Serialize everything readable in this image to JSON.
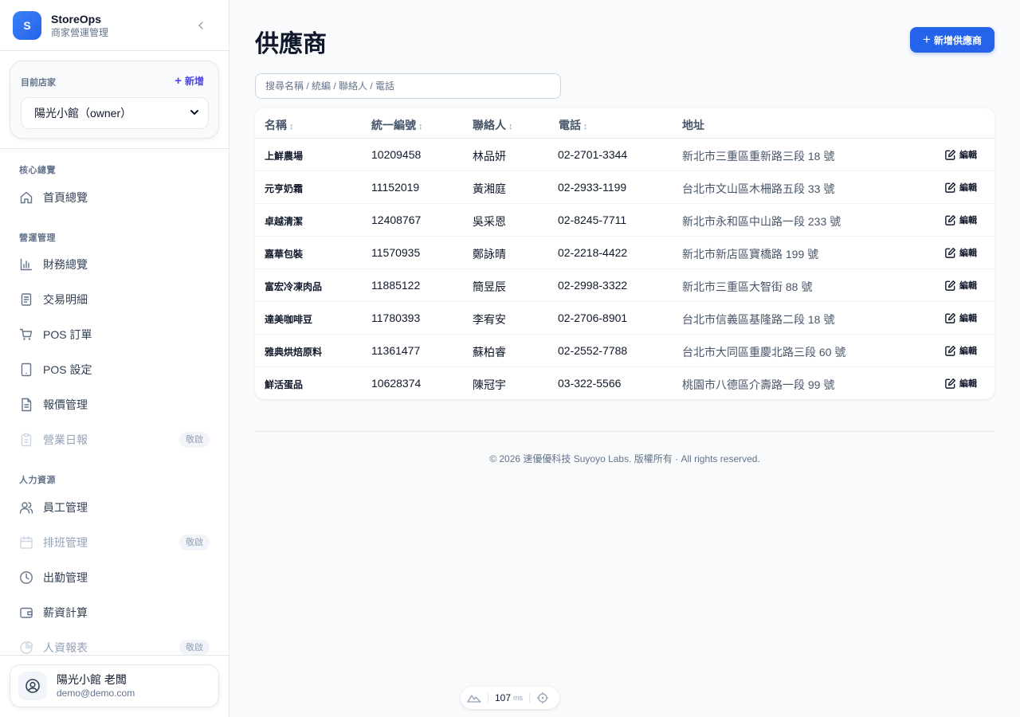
{
  "brand": {
    "logo_letter": "S",
    "name": "StoreOps",
    "subtitle": "商家營運管理"
  },
  "store": {
    "label": "目前店家",
    "add_label": "新增",
    "selected": "陽光小館（owner）"
  },
  "nav": {
    "sections": [
      {
        "title": "核心總覽"
      },
      {
        "title": "營運管理"
      },
      {
        "title": "人力資源"
      }
    ],
    "items": [
      {
        "label": "首頁總覽",
        "icon": "home-icon"
      },
      {
        "label": "財務總覽",
        "icon": "bar-chart-icon"
      },
      {
        "label": "交易明細",
        "icon": "receipt-icon"
      },
      {
        "label": "POS 訂單",
        "icon": "cart-icon"
      },
      {
        "label": "POS 設定",
        "icon": "tablet-icon"
      },
      {
        "label": "報價管理",
        "icon": "document-icon"
      },
      {
        "label": "營業日報",
        "icon": "clipboard-icon",
        "badge": "敬啟"
      },
      {
        "label": "員工管理",
        "icon": "users-icon"
      },
      {
        "label": "排班管理",
        "icon": "calendar-icon",
        "badge": "敬啟"
      },
      {
        "label": "出勤管理",
        "icon": "clock-icon"
      },
      {
        "label": "薪資計算",
        "icon": "wallet-icon"
      },
      {
        "label": "人資報表",
        "icon": "pie-chart-icon",
        "badge": "敬啟"
      }
    ]
  },
  "user": {
    "name": "陽光小館 老闆",
    "email": "demo@demo.com"
  },
  "page": {
    "title": "供應商",
    "add_button": "新增供應商",
    "search_placeholder": "搜尋名稱 / 統編 / 聯絡人 / 電話",
    "search_value": ""
  },
  "table": {
    "headers": {
      "name": "名稱",
      "tax_id": "統一編號",
      "contact": "聯絡人",
      "phone": "電話",
      "address": "地址",
      "sort_glyph": "↕"
    },
    "edit_label": "編輯",
    "rows": [
      {
        "name": "上鮮農場",
        "tax_id": "10209458",
        "contact": "林品妍",
        "phone": "02-2701-3344",
        "address": "新北市三重區重新路三段 18 號"
      },
      {
        "name": "元亨奶霜",
        "tax_id": "11152019",
        "contact": "黃湘庭",
        "phone": "02-2933-1199",
        "address": "台北市文山區木柵路五段 33 號"
      },
      {
        "name": "卓越清潔",
        "tax_id": "12408767",
        "contact": "吳采恩",
        "phone": "02-8245-7711",
        "address": "新北市永和區中山路一段 233 號"
      },
      {
        "name": "嘉華包裝",
        "tax_id": "11570935",
        "contact": "鄭詠晴",
        "phone": "02-2218-4422",
        "address": "新北市新店區寶橋路 199 號"
      },
      {
        "name": "富宏冷凍肉品",
        "tax_id": "11885122",
        "contact": "簡昱辰",
        "phone": "02-2998-3322",
        "address": "新北市三重區大智街 88 號"
      },
      {
        "name": "達美咖啡豆",
        "tax_id": "11780393",
        "contact": "李宥安",
        "phone": "02-2706-8901",
        "address": "台北市信義區基隆路二段 18 號"
      },
      {
        "name": "雅典烘焙原料",
        "tax_id": "11361477",
        "contact": "蘇柏睿",
        "phone": "02-2552-7788",
        "address": "台北市大同區重慶北路三段 60 號"
      },
      {
        "name": "鮮活蛋品",
        "tax_id": "10628374",
        "contact": "陳冠宇",
        "phone": "03-322-5566",
        "address": "桃園市八德區介壽路一段 99 號"
      }
    ]
  },
  "footer": {
    "text": "© 2026 速優優科技 Suyoyo Labs. 版權所有 · All rights reserved."
  },
  "devbar": {
    "ms_value": "107",
    "ms_unit": "ms"
  },
  "colors": {
    "accent": "#2563eb",
    "brand_gradient_start": "#3b82f6",
    "text": "#0f172a",
    "muted": "#64748b"
  }
}
